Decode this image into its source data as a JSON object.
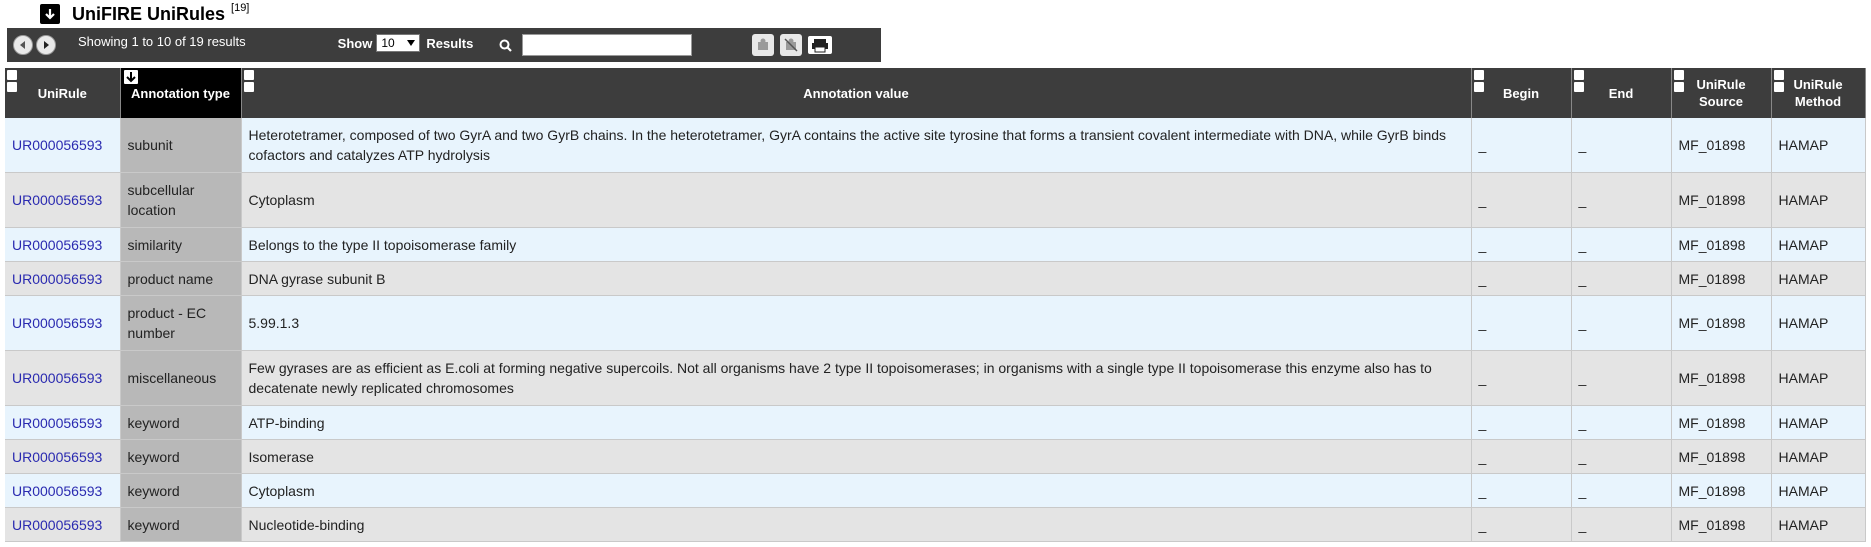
{
  "header": {
    "title": "UniFIRE UniRules",
    "count_label": "[19]"
  },
  "toolbar": {
    "showing_text": "Showing 1 to 10 of 19 results",
    "show_label": "Show",
    "page_size": "10",
    "results_label": "Results",
    "search_value": ""
  },
  "columns": {
    "unirule": "UniRule",
    "annotation_type": "Annotation type",
    "annotation_value": "Annotation value",
    "begin": "Begin",
    "end": "End",
    "unirule_source": "UniRule Source",
    "unirule_method": "UniRule Method"
  },
  "rows": [
    {
      "rule": "UR000056593",
      "type": "subunit",
      "value": "Heterotetramer, composed of two GyrA and two GyrB chains. In the heterotetramer, GyrA contains the active site tyrosine that forms a transient covalent intermediate with DNA, while GyrB binds cofactors and catalyzes ATP hydrolysis",
      "begin": "_",
      "end": "_",
      "source": "MF_01898",
      "method": "HAMAP"
    },
    {
      "rule": "UR000056593",
      "type": "subcellular location",
      "value": "Cytoplasm",
      "begin": "_",
      "end": "_",
      "source": "MF_01898",
      "method": "HAMAP"
    },
    {
      "rule": "UR000056593",
      "type": "similarity",
      "value": "Belongs to the type II topoisomerase family",
      "begin": "_",
      "end": "_",
      "source": "MF_01898",
      "method": "HAMAP"
    },
    {
      "rule": "UR000056593",
      "type": "product name",
      "value": "DNA gyrase subunit B",
      "begin": "_",
      "end": "_",
      "source": "MF_01898",
      "method": "HAMAP"
    },
    {
      "rule": "UR000056593",
      "type": "product - EC number",
      "value": "5.99.1.3",
      "begin": "_",
      "end": "_",
      "source": "MF_01898",
      "method": "HAMAP"
    },
    {
      "rule": "UR000056593",
      "type": "miscellaneous",
      "value": "Few gyrases are as efficient as E.coli at forming negative supercoils. Not all organisms have 2 type II topoisomerases; in organisms with a single type II topoisomerase this enzyme also has to decatenate newly replicated chromosomes",
      "begin": "_",
      "end": "_",
      "source": "MF_01898",
      "method": "HAMAP"
    },
    {
      "rule": "UR000056593",
      "type": "keyword",
      "value": "ATP-binding",
      "begin": "_",
      "end": "_",
      "source": "MF_01898",
      "method": "HAMAP"
    },
    {
      "rule": "UR000056593",
      "type": "keyword",
      "value": "Isomerase",
      "begin": "_",
      "end": "_",
      "source": "MF_01898",
      "method": "HAMAP"
    },
    {
      "rule": "UR000056593",
      "type": "keyword",
      "value": "Cytoplasm",
      "begin": "_",
      "end": "_",
      "source": "MF_01898",
      "method": "HAMAP"
    },
    {
      "rule": "UR000056593",
      "type": "keyword",
      "value": "Nucleotide-binding",
      "begin": "_",
      "end": "_",
      "source": "MF_01898",
      "method": "HAMAP"
    }
  ]
}
